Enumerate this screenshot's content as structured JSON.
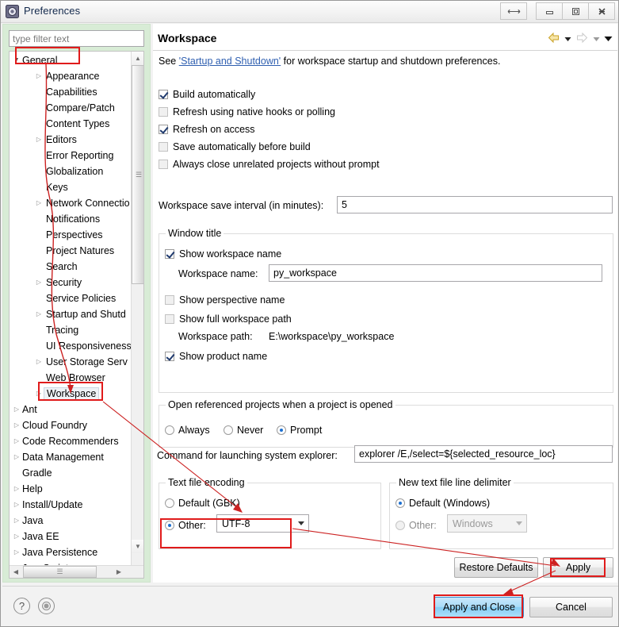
{
  "window": {
    "title": "Preferences",
    "controls": [
      {
        "name": "resize-button",
        "glyph": "⇔"
      },
      {
        "name": "minimize-button",
        "glyph": "–"
      },
      {
        "name": "maximize-button",
        "glyph": "□"
      },
      {
        "name": "close-button",
        "glyph": "✕"
      }
    ]
  },
  "sidebar": {
    "filter_placeholder": "type filter text",
    "filter_value": "",
    "selected": "Workspace",
    "tree": [
      {
        "label": "General",
        "level": 0,
        "arrow": "expanded"
      },
      {
        "label": "Appearance",
        "level": 1,
        "arrow": "collapsed"
      },
      {
        "label": "Capabilities",
        "level": 1,
        "arrow": "none"
      },
      {
        "label": "Compare/Patch",
        "level": 1,
        "arrow": "none"
      },
      {
        "label": "Content Types",
        "level": 1,
        "arrow": "none"
      },
      {
        "label": "Editors",
        "level": 1,
        "arrow": "collapsed"
      },
      {
        "label": "Error Reporting",
        "level": 1,
        "arrow": "none"
      },
      {
        "label": "Globalization",
        "level": 1,
        "arrow": "none"
      },
      {
        "label": "Keys",
        "level": 1,
        "arrow": "none"
      },
      {
        "label": "Network Connectio",
        "level": 1,
        "arrow": "collapsed"
      },
      {
        "label": "Notifications",
        "level": 1,
        "arrow": "none"
      },
      {
        "label": "Perspectives",
        "level": 1,
        "arrow": "none"
      },
      {
        "label": "Project Natures",
        "level": 1,
        "arrow": "none"
      },
      {
        "label": "Search",
        "level": 1,
        "arrow": "none"
      },
      {
        "label": "Security",
        "level": 1,
        "arrow": "collapsed"
      },
      {
        "label": "Service Policies",
        "level": 1,
        "arrow": "none"
      },
      {
        "label": "Startup and Shutd",
        "level": 1,
        "arrow": "collapsed"
      },
      {
        "label": "Tracing",
        "level": 1,
        "arrow": "none"
      },
      {
        "label": "UI Responsiveness",
        "level": 1,
        "arrow": "none"
      },
      {
        "label": "User Storage Serv",
        "level": 1,
        "arrow": "collapsed"
      },
      {
        "label": "Web Browser",
        "level": 1,
        "arrow": "none"
      },
      {
        "label": "Workspace",
        "level": 1,
        "arrow": "collapsed",
        "selected": true
      },
      {
        "label": "Ant",
        "level": 0,
        "arrow": "collapsed"
      },
      {
        "label": "Cloud Foundry",
        "level": 0,
        "arrow": "collapsed"
      },
      {
        "label": "Code Recommenders",
        "level": 0,
        "arrow": "collapsed"
      },
      {
        "label": "Data Management",
        "level": 0,
        "arrow": "collapsed"
      },
      {
        "label": "Gradle",
        "level": 0,
        "arrow": "none"
      },
      {
        "label": "Help",
        "level": 0,
        "arrow": "collapsed"
      },
      {
        "label": "Install/Update",
        "level": 0,
        "arrow": "collapsed"
      },
      {
        "label": "Java",
        "level": 0,
        "arrow": "collapsed"
      },
      {
        "label": "Java EE",
        "level": 0,
        "arrow": "collapsed"
      },
      {
        "label": "Java Persistence",
        "level": 0,
        "arrow": "collapsed"
      },
      {
        "label": "JavaScript",
        "level": 0,
        "arrow": "collapsed"
      }
    ]
  },
  "page": {
    "title": "Workspace",
    "intro_before": "See ",
    "intro_link": "'Startup and Shutdown'",
    "intro_after": " for workspace startup and shutdown preferences.",
    "checkboxes": [
      {
        "label": "Build automatically",
        "checked": true
      },
      {
        "label": "Refresh using native hooks or polling",
        "checked": false
      },
      {
        "label": "Refresh on access",
        "checked": true
      },
      {
        "label": "Save automatically before build",
        "checked": false
      },
      {
        "label": "Always close unrelated projects without prompt",
        "checked": false
      }
    ],
    "save_interval": {
      "label": "Workspace save interval (in minutes):",
      "value": "5"
    },
    "window_title_group": {
      "title": "Window title",
      "show_workspace_name": {
        "label": "Show workspace name",
        "checked": true
      },
      "workspace_name": {
        "label": "Workspace name:",
        "value": "py_workspace"
      },
      "show_perspective_name": {
        "label": "Show perspective name",
        "checked": false
      },
      "show_full_workspace_path": {
        "label": "Show full workspace path",
        "checked": false
      },
      "workspace_path": {
        "label": "Workspace path:",
        "value": "E:\\workspace\\py_workspace"
      },
      "show_product_name": {
        "label": "Show product name",
        "checked": true
      }
    },
    "open_referenced_group": {
      "title": "Open referenced projects when a project is opened",
      "options": [
        {
          "label": "Always",
          "selected": false
        },
        {
          "label": "Never",
          "selected": false
        },
        {
          "label": "Prompt",
          "selected": true
        }
      ]
    },
    "command_explorer": {
      "label": "Command for launching system explorer:",
      "value": "explorer /E,/select=${selected_resource_loc}"
    },
    "text_file_encoding": {
      "title": "Text file encoding",
      "default_option": {
        "label": "Default (GBK)",
        "selected": false
      },
      "other_option": {
        "label": "Other:",
        "selected": true
      },
      "other_value": "UTF-8"
    },
    "line_delimiter": {
      "title": "New text file line delimiter",
      "default_option": {
        "label": "Default (Windows)",
        "selected": true
      },
      "other_option": {
        "label": "Other:",
        "selected": false,
        "disabled": true
      },
      "other_value": "Windows"
    }
  },
  "buttons": {
    "restore_defaults": "Restore Defaults",
    "apply": "Apply",
    "apply_and_close": "Apply and Close",
    "cancel": "Cancel"
  },
  "footer_icons": [
    {
      "name": "help-icon",
      "glyph": "?"
    },
    {
      "name": "record-icon",
      "glyph": "◉"
    }
  ],
  "nav": {
    "back": "back-arrow-icon",
    "back_menu": "back-dropdown-icon",
    "forward": "forward-arrow-icon",
    "forward_menu": "forward-dropdown-icon",
    "view_menu": "view-menu-icon"
  },
  "annotation_color": "#e01b1b"
}
